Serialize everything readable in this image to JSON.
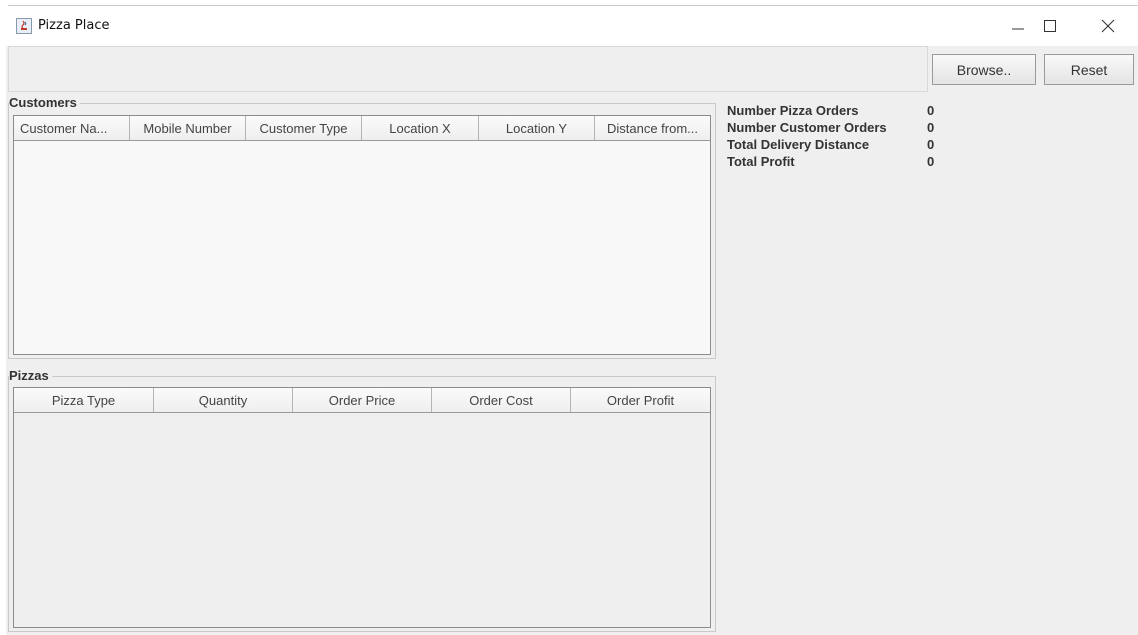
{
  "window": {
    "title": "Pizza Place",
    "controls": [
      "minimize-icon",
      "maximize-icon",
      "close-icon"
    ]
  },
  "toolbar": {
    "browse_label": "Browse..",
    "reset_label": "Reset"
  },
  "customers": {
    "title": "Customers",
    "columns": [
      "Customer Na...",
      "Mobile Number",
      "Customer Type",
      "Location X",
      "Location Y",
      "Distance from..."
    ],
    "rows": []
  },
  "pizzas": {
    "title": "Pizzas",
    "columns": [
      "Pizza Type",
      "Quantity",
      "Order Price",
      "Order Cost",
      "Order Profit"
    ],
    "rows": []
  },
  "stats": [
    {
      "label": "Number Pizza Orders",
      "value": "0"
    },
    {
      "label": "Number Customer Orders",
      "value": "0"
    },
    {
      "label": "Total Delivery Distance",
      "value": "0"
    },
    {
      "label": "Total Profit",
      "value": "0"
    }
  ],
  "colors": {
    "window_bg": "#efefef",
    "table_bg": "#f8f8f8"
  }
}
